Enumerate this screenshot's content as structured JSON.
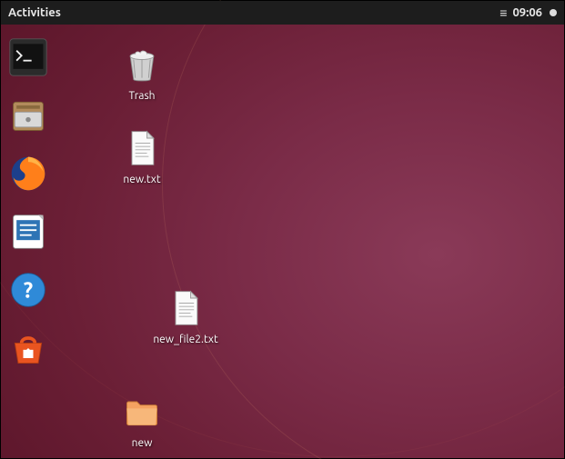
{
  "topbar": {
    "activities_label": "Activities",
    "clock": "09:06"
  },
  "dock": {
    "items": [
      {
        "name": "terminal"
      },
      {
        "name": "files"
      },
      {
        "name": "firefox"
      },
      {
        "name": "libreoffice-writer"
      },
      {
        "name": "help"
      },
      {
        "name": "software-center"
      }
    ]
  },
  "desktop": {
    "icons": [
      {
        "id": "trash",
        "label": "Trash",
        "type": "trash"
      },
      {
        "id": "new-txt",
        "label": "new.txt",
        "type": "text"
      },
      {
        "id": "new-file2",
        "label": "new_file2.txt",
        "type": "text"
      },
      {
        "id": "new-folder",
        "label": "new",
        "type": "folder"
      }
    ]
  },
  "colors": {
    "accent_orange": "#e95420",
    "topbar_bg": "#1d1d1d"
  }
}
